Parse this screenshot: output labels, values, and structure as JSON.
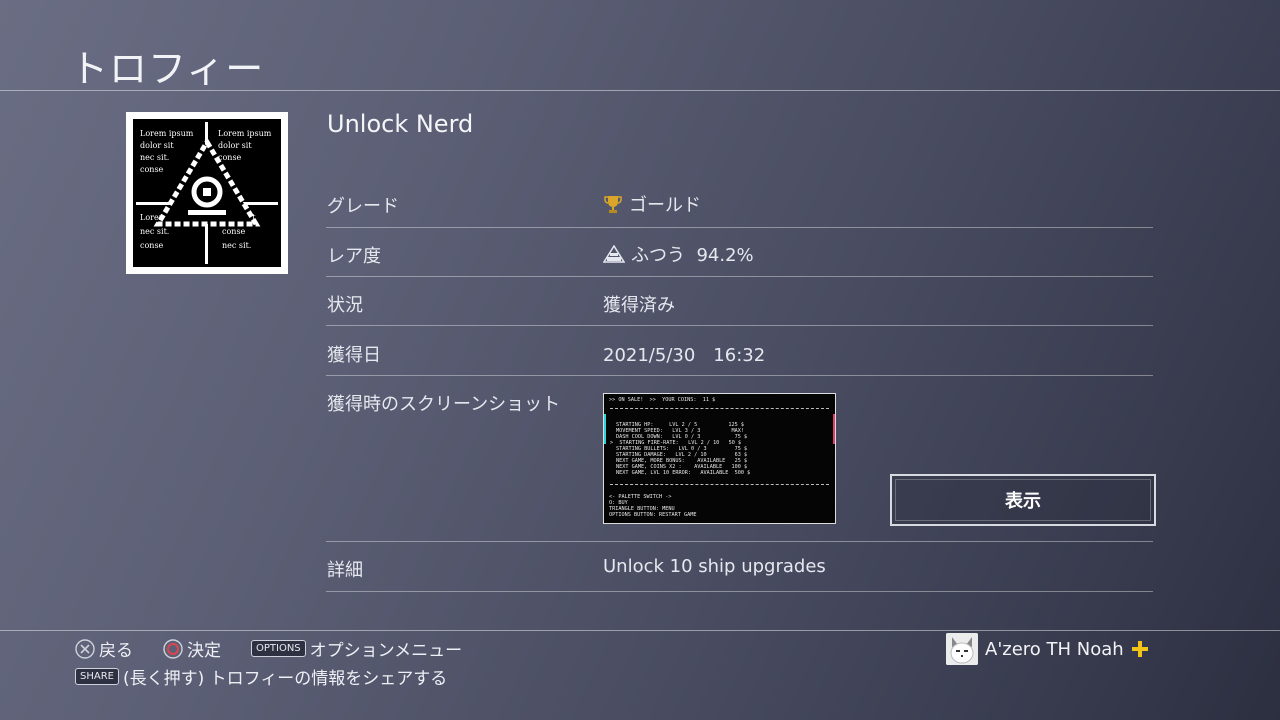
{
  "header": {
    "title": "トロフィー"
  },
  "trophy": {
    "name": "Unlock Nerd",
    "icon_lorem": [
      "Lorem ipsum",
      "dolor sit",
      "nec sit.",
      "conse"
    ]
  },
  "details": {
    "grade_label": "グレード",
    "grade_value": "ゴールド",
    "grade_color": "#d9a62a",
    "rarity_label": "レア度",
    "rarity_value": "ふつう  94.2%",
    "status_label": "状況",
    "status_value": "獲得済み",
    "date_label": "獲得日",
    "date_value": "2021/5/30　16:32",
    "screenshot_label": "獲得時のスクリーンショット",
    "view_button": "表示",
    "desc_label": "詳細",
    "desc_value": "Unlock 10 ship upgrades"
  },
  "screenshot": {
    "top": ">> ON SALE!  >>  YOUR COINS:  11 $",
    "lines": [
      "STARTING HP:     LVL 2 / 5          125 $",
      "MOVEMENT SPEED:   LVL 3 / 3          MAX!",
      "DASH COOL DOWN:   LVL 0 / 3           75 $",
      ">  STARTING FIRE-RATE:   LVL 2 / 10   50 $",
      "STARTING BULLETS:   LVL 0 / 3         75 $",
      "STARTING DAMAGE:   LVL 2 / 10         63 $",
      "NEXT GAME, MORE BONUS:    AVAILABLE   25 $",
      "NEXT GAME, COINS X2 :    AVAILABLE   100 $",
      "NEXT GAME, LVL 10 ERROR:   AVAILABLE  500 $"
    ],
    "bottom": [
      "<- PALETTE SWITCH ->",
      "O: BUY",
      "TRIANGLE BUTTON: MENU",
      "OPTIONS BUTTON: RESTART GAME"
    ]
  },
  "footer": {
    "back": "戻る",
    "confirm": "決定",
    "options_key": "OPTIONS",
    "options_label": "オプションメニュー",
    "share_key": "SHARE",
    "share_label": "(長く押す) トロフィーの情報をシェアする"
  },
  "user": {
    "name": "A'zero TH Noah",
    "plus_color": "#f2c318"
  }
}
